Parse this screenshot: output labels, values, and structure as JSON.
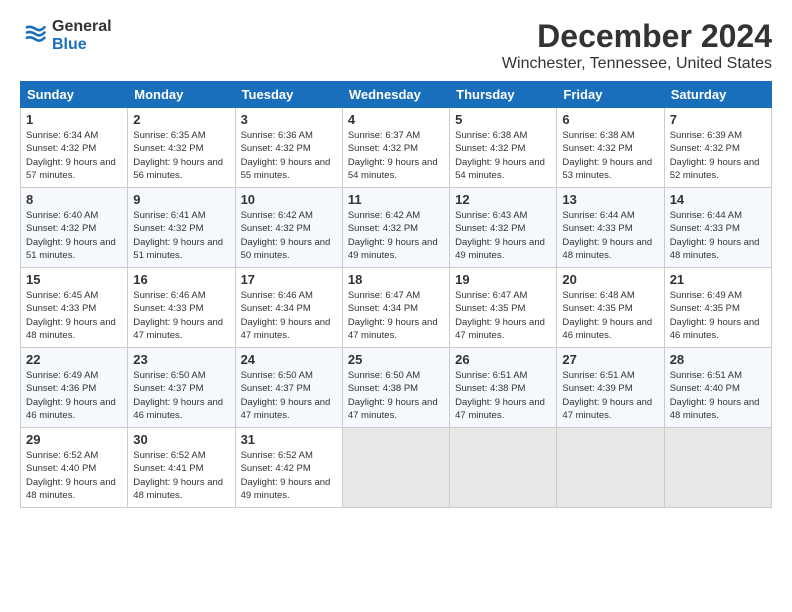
{
  "logo": {
    "general": "General",
    "blue": "Blue"
  },
  "title": "December 2024",
  "location": "Winchester, Tennessee, United States",
  "days_of_week": [
    "Sunday",
    "Monday",
    "Tuesday",
    "Wednesday",
    "Thursday",
    "Friday",
    "Saturday"
  ],
  "weeks": [
    [
      {
        "day": "1",
        "sunrise": "6:34 AM",
        "sunset": "4:32 PM",
        "daylight": "9 hours and 57 minutes."
      },
      {
        "day": "2",
        "sunrise": "6:35 AM",
        "sunset": "4:32 PM",
        "daylight": "9 hours and 56 minutes."
      },
      {
        "day": "3",
        "sunrise": "6:36 AM",
        "sunset": "4:32 PM",
        "daylight": "9 hours and 55 minutes."
      },
      {
        "day": "4",
        "sunrise": "6:37 AM",
        "sunset": "4:32 PM",
        "daylight": "9 hours and 54 minutes."
      },
      {
        "day": "5",
        "sunrise": "6:38 AM",
        "sunset": "4:32 PM",
        "daylight": "9 hours and 54 minutes."
      },
      {
        "day": "6",
        "sunrise": "6:38 AM",
        "sunset": "4:32 PM",
        "daylight": "9 hours and 53 minutes."
      },
      {
        "day": "7",
        "sunrise": "6:39 AM",
        "sunset": "4:32 PM",
        "daylight": "9 hours and 52 minutes."
      }
    ],
    [
      {
        "day": "8",
        "sunrise": "6:40 AM",
        "sunset": "4:32 PM",
        "daylight": "9 hours and 51 minutes."
      },
      {
        "day": "9",
        "sunrise": "6:41 AM",
        "sunset": "4:32 PM",
        "daylight": "9 hours and 51 minutes."
      },
      {
        "day": "10",
        "sunrise": "6:42 AM",
        "sunset": "4:32 PM",
        "daylight": "9 hours and 50 minutes."
      },
      {
        "day": "11",
        "sunrise": "6:42 AM",
        "sunset": "4:32 PM",
        "daylight": "9 hours and 49 minutes."
      },
      {
        "day": "12",
        "sunrise": "6:43 AM",
        "sunset": "4:32 PM",
        "daylight": "9 hours and 49 minutes."
      },
      {
        "day": "13",
        "sunrise": "6:44 AM",
        "sunset": "4:33 PM",
        "daylight": "9 hours and 48 minutes."
      },
      {
        "day": "14",
        "sunrise": "6:44 AM",
        "sunset": "4:33 PM",
        "daylight": "9 hours and 48 minutes."
      }
    ],
    [
      {
        "day": "15",
        "sunrise": "6:45 AM",
        "sunset": "4:33 PM",
        "daylight": "9 hours and 48 minutes."
      },
      {
        "day": "16",
        "sunrise": "6:46 AM",
        "sunset": "4:33 PM",
        "daylight": "9 hours and 47 minutes."
      },
      {
        "day": "17",
        "sunrise": "6:46 AM",
        "sunset": "4:34 PM",
        "daylight": "9 hours and 47 minutes."
      },
      {
        "day": "18",
        "sunrise": "6:47 AM",
        "sunset": "4:34 PM",
        "daylight": "9 hours and 47 minutes."
      },
      {
        "day": "19",
        "sunrise": "6:47 AM",
        "sunset": "4:35 PM",
        "daylight": "9 hours and 47 minutes."
      },
      {
        "day": "20",
        "sunrise": "6:48 AM",
        "sunset": "4:35 PM",
        "daylight": "9 hours and 46 minutes."
      },
      {
        "day": "21",
        "sunrise": "6:49 AM",
        "sunset": "4:35 PM",
        "daylight": "9 hours and 46 minutes."
      }
    ],
    [
      {
        "day": "22",
        "sunrise": "6:49 AM",
        "sunset": "4:36 PM",
        "daylight": "9 hours and 46 minutes."
      },
      {
        "day": "23",
        "sunrise": "6:50 AM",
        "sunset": "4:37 PM",
        "daylight": "9 hours and 46 minutes."
      },
      {
        "day": "24",
        "sunrise": "6:50 AM",
        "sunset": "4:37 PM",
        "daylight": "9 hours and 47 minutes."
      },
      {
        "day": "25",
        "sunrise": "6:50 AM",
        "sunset": "4:38 PM",
        "daylight": "9 hours and 47 minutes."
      },
      {
        "day": "26",
        "sunrise": "6:51 AM",
        "sunset": "4:38 PM",
        "daylight": "9 hours and 47 minutes."
      },
      {
        "day": "27",
        "sunrise": "6:51 AM",
        "sunset": "4:39 PM",
        "daylight": "9 hours and 47 minutes."
      },
      {
        "day": "28",
        "sunrise": "6:51 AM",
        "sunset": "4:40 PM",
        "daylight": "9 hours and 48 minutes."
      }
    ],
    [
      {
        "day": "29",
        "sunrise": "6:52 AM",
        "sunset": "4:40 PM",
        "daylight": "9 hours and 48 minutes."
      },
      {
        "day": "30",
        "sunrise": "6:52 AM",
        "sunset": "4:41 PM",
        "daylight": "9 hours and 48 minutes."
      },
      {
        "day": "31",
        "sunrise": "6:52 AM",
        "sunset": "4:42 PM",
        "daylight": "9 hours and 49 minutes."
      },
      null,
      null,
      null,
      null
    ]
  ]
}
